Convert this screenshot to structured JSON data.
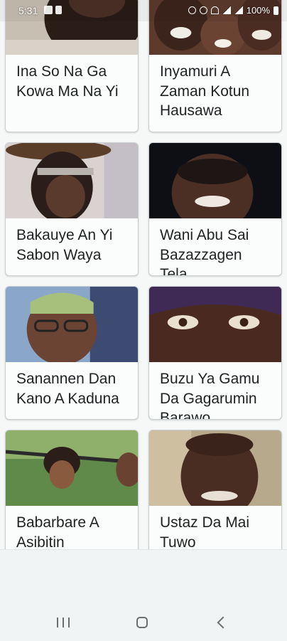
{
  "status_bar": {
    "time": "5:31",
    "battery_text": "100%"
  },
  "cards": [
    {
      "title": "Ina So Na Ga Kowa Ma Na Yi"
    },
    {
      "title": "Inyamuri A Zaman Kotun Hausawa"
    },
    {
      "title": "Bakauye An Yi Sabon Waya"
    },
    {
      "title": "Wani Abu Sai Bazazzagen Tela"
    },
    {
      "title": "Sanannen Dan Kano A Kaduna"
    },
    {
      "title": "Buzu Ya Gamu Da Gagarumin Barawo"
    },
    {
      "title": "Babarbare A Asibitin Mahaukata"
    },
    {
      "title": "Ustaz Da Mai Tuwo"
    }
  ]
}
